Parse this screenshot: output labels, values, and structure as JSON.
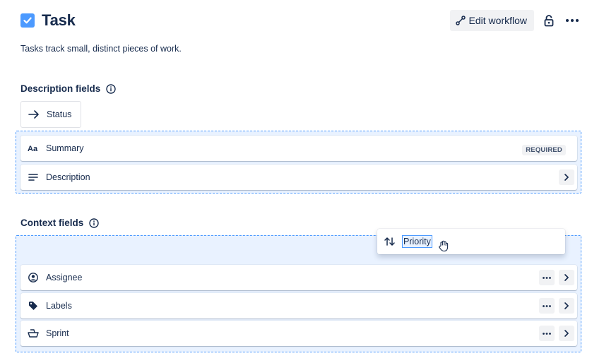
{
  "header": {
    "title": "Task",
    "edit_workflow_label": "Edit workflow",
    "icons": [
      "checkbox-icon",
      "workflow-icon",
      "lock-icon",
      "more-icon"
    ]
  },
  "subtitle": "Tasks track small, distinct pieces of work.",
  "description_section": {
    "title": "Description fields",
    "chip_label": "Status",
    "fields": [
      {
        "label": "Summary",
        "icon": "text-icon",
        "badge": "REQUIRED"
      },
      {
        "label": "Description",
        "icon": "paragraph-icon"
      }
    ]
  },
  "context_section": {
    "title": "Context fields",
    "dragging_label": "Priority",
    "fields": [
      {
        "label": "Assignee",
        "icon": "person-icon"
      },
      {
        "label": "Labels",
        "icon": "tag-icon"
      },
      {
        "label": "Sprint",
        "icon": "sprint-icon"
      }
    ]
  },
  "colors": {
    "accent": "#4c9aff",
    "drop_zone_bg": "#e9f2ff",
    "text": "#172b4d"
  }
}
